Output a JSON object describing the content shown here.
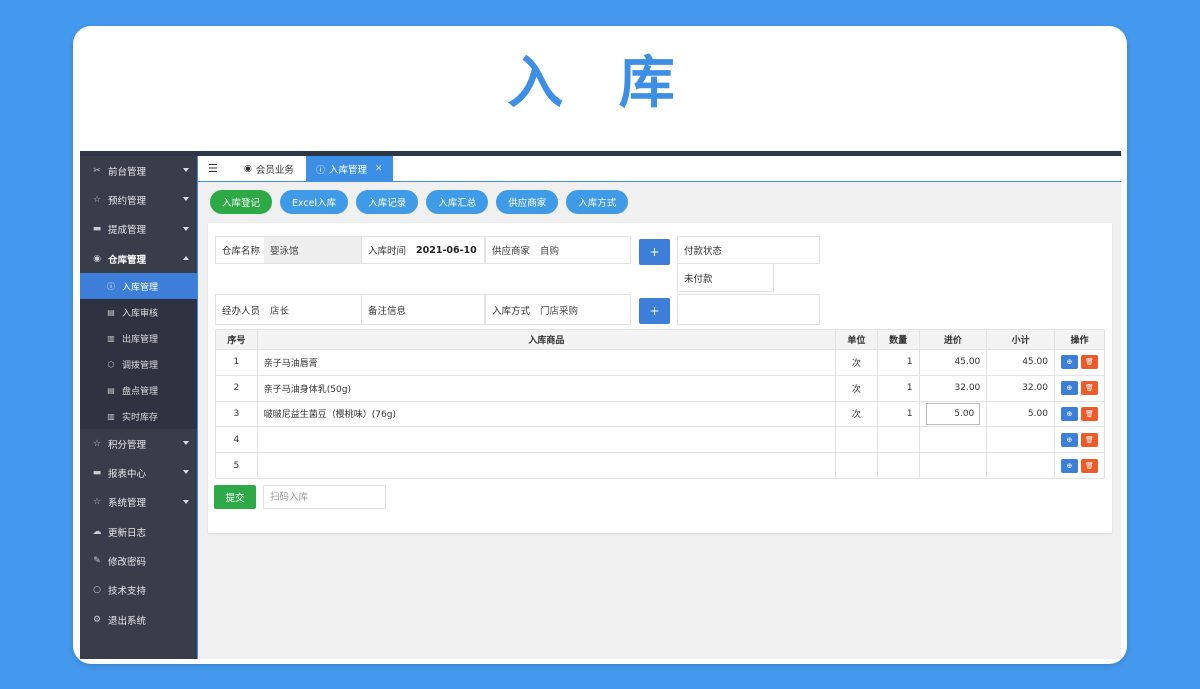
{
  "page": {
    "title": "入 库"
  },
  "sidebar": {
    "items": [
      {
        "label": "前台管理",
        "icon": "tools-icon",
        "expanded": false
      },
      {
        "label": "预约管理",
        "icon": "star-icon",
        "expanded": false
      },
      {
        "label": "提成管理",
        "icon": "monitor-icon",
        "expanded": false
      },
      {
        "label": "仓库管理",
        "icon": "dashboard-icon",
        "expanded": true,
        "children": [
          {
            "label": "入库管理",
            "icon": "info-circle-icon",
            "active": true
          },
          {
            "label": "入库审核",
            "icon": "table-icon"
          },
          {
            "label": "出库管理",
            "icon": "clipboard-icon"
          },
          {
            "label": "调拨管理",
            "icon": "cube-icon"
          },
          {
            "label": "盘点管理",
            "icon": "table-icon"
          },
          {
            "label": "实时库存",
            "icon": "clipboard-icon"
          }
        ]
      },
      {
        "label": "积分管理",
        "icon": "star-icon",
        "expanded": false
      },
      {
        "label": "报表中心",
        "icon": "monitor-icon",
        "expanded": false
      },
      {
        "label": "系统管理",
        "icon": "star-icon",
        "expanded": false
      },
      {
        "label": "更新日志",
        "icon": "cloud-icon"
      },
      {
        "label": "修改密码",
        "icon": "edit-icon"
      },
      {
        "label": "技术支持",
        "icon": "circle-icon"
      },
      {
        "label": "退出系统",
        "icon": "gears-icon"
      }
    ]
  },
  "tabs": [
    {
      "label": "会员业务",
      "icon": "dashboard-icon"
    },
    {
      "label": "入库管理",
      "icon": "info-circle-icon",
      "active": true
    }
  ],
  "toolbar": {
    "buttons": [
      "入库登记",
      "Excel入库",
      "入库记录",
      "入库汇总",
      "供应商家",
      "入库方式"
    ]
  },
  "form": {
    "warehouse_label": "仓库名称",
    "warehouse_value": "婴泳馆",
    "time_label": "入库时间",
    "time_value": "2021-06-10",
    "supplier_label": "供应商家",
    "supplier_value": "自购",
    "payment_label": "付款状态",
    "payment_value": "未付款",
    "handler_label": "经办人员",
    "handler_value": "店长",
    "remark_label": "备注信息",
    "remark_value": "",
    "method_label": "入库方式",
    "method_value": "门店采购",
    "plus": "+"
  },
  "table": {
    "headers": [
      "序号",
      "入库商品",
      "单位",
      "数量",
      "进价",
      "小计",
      "操作"
    ],
    "rows": [
      {
        "no": "1",
        "product": "亲子马油唇膏",
        "unit": "次",
        "qty": "1",
        "price": "45.00",
        "subtotal": "45.00"
      },
      {
        "no": "2",
        "product": "亲子马油身体乳(50g)",
        "unit": "次",
        "qty": "1",
        "price": "32.00",
        "subtotal": "32.00"
      },
      {
        "no": "3",
        "product": "啵啵尼益生菌豆（樱桃味）(76g)",
        "unit": "次",
        "qty": "1",
        "price": "5.00",
        "subtotal": "5.00"
      },
      {
        "no": "4",
        "product": "",
        "unit": "",
        "qty": "",
        "price": "",
        "subtotal": ""
      },
      {
        "no": "5",
        "product": "",
        "unit": "",
        "qty": "",
        "price": "",
        "subtotal": ""
      }
    ]
  },
  "footer": {
    "submit_label": "提交",
    "scan_placeholder": "扫码入库"
  },
  "colors": {
    "background": "#4499ee",
    "accent": "#3d8fe6",
    "sidebar": "#393d49",
    "green": "#2daa47",
    "delete": "#f05a28"
  }
}
